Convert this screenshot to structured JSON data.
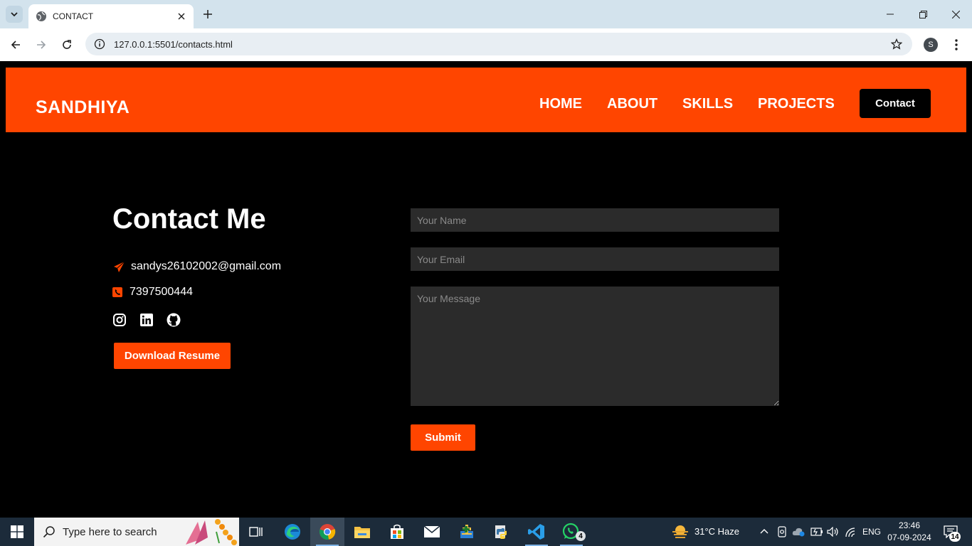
{
  "browser": {
    "tab_title": "CONTACT",
    "url": "127.0.0.1:5501/contacts.html",
    "profile_initial": "S"
  },
  "site": {
    "brand": "SANDHIYA",
    "nav": [
      "HOME",
      "ABOUT",
      "SKILLS",
      "PROJECTS"
    ],
    "contact_button": "Contact",
    "accent_color": "#ff4500"
  },
  "contact": {
    "heading": "Contact Me",
    "email": "sandys26102002@gmail.com",
    "phone": "7397500444",
    "socials": [
      "instagram-icon",
      "linkedin-icon",
      "github-icon"
    ],
    "download_button": "Download Resume"
  },
  "form": {
    "name_placeholder": "Your Name",
    "email_placeholder": "Your Email",
    "message_placeholder": "Your Message",
    "submit_label": "Submit"
  },
  "taskbar": {
    "search_placeholder": "Type here to search",
    "weather": "31°C  Haze",
    "language": "ENG",
    "time": "23:46",
    "date": "07-09-2024",
    "whatsapp_badge": "4",
    "notifications": "14"
  }
}
